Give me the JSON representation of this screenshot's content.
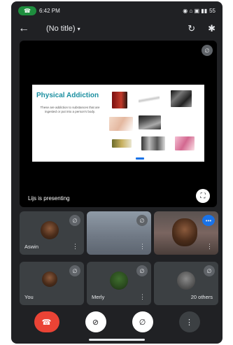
{
  "status_bar": {
    "time": "6:42 PM",
    "right_icons": "◉ ⌂ ▣ ▮▮",
    "battery": "55"
  },
  "meeting": {
    "title": "(No title)",
    "presenter_text": "Lijs is presenting"
  },
  "slide": {
    "title": "Physical Addiction",
    "body": "These are addiction to substances that are ingested or put into a person's body."
  },
  "participants": [
    {
      "name": "Aswin",
      "muted": true
    },
    {
      "name": "",
      "muted": true
    },
    {
      "name": "",
      "muted": false
    },
    {
      "name": "You",
      "muted": true
    },
    {
      "name": "Merly",
      "muted": true
    },
    {
      "name": "20 others",
      "muted": true
    }
  ],
  "colors": {
    "background": "#202124",
    "tile": "#3c4043",
    "end_call": "#ea4335",
    "accent_blue": "#1a73e8",
    "slide_title": "#1a8fa0"
  },
  "icons": {
    "back": "←",
    "switch_camera": "↻",
    "bluetooth": "✱",
    "mic_off": "∅",
    "more": "⋮",
    "fullscreen": "⛶",
    "end_call": "☎",
    "camera_off": "⊘"
  }
}
